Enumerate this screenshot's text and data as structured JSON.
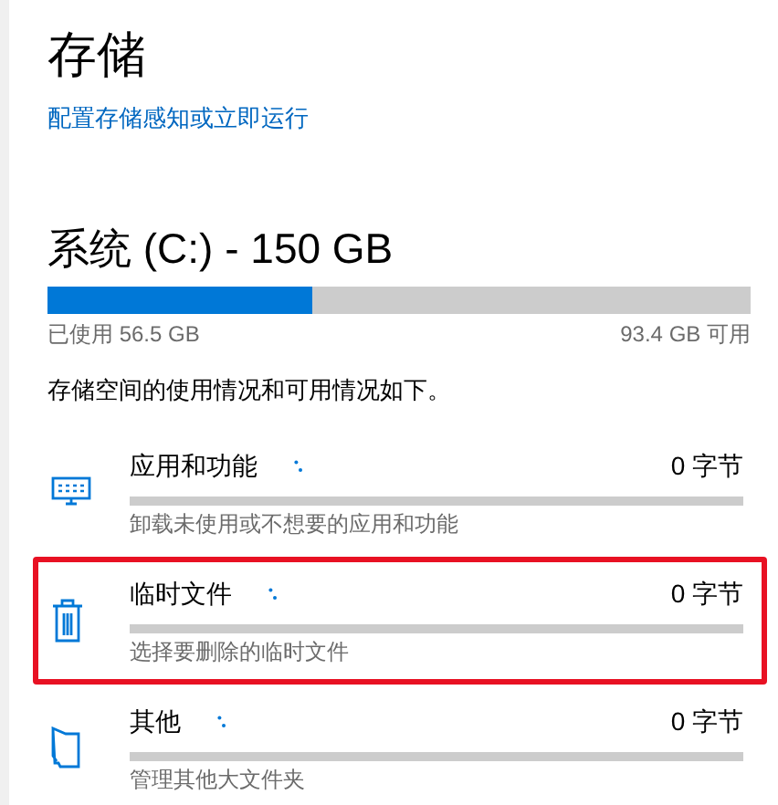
{
  "title": "存储",
  "link": "配置存储感知或立即运行",
  "drive": {
    "title": "系统 (C:) - 150 GB",
    "level": 0.377,
    "used": "已使用 56.5 GB",
    "free": "93.4 GB 可用"
  },
  "summary": "存储空间的使用情况和可用情况如下。",
  "categories": [
    {
      "kind": "apps",
      "name": "应用和功能",
      "size": "0 字节",
      "description": "卸载未使用或不想要的应用和功能",
      "highlighted": false
    },
    {
      "kind": "temp",
      "name": "临时文件",
      "size": "0 字节",
      "description": "选择要删除的临时文件",
      "highlighted": true
    },
    {
      "kind": "other",
      "name": "其他",
      "size": "0 字节",
      "description": "管理其他大文件夹",
      "highlighted": false
    }
  ]
}
